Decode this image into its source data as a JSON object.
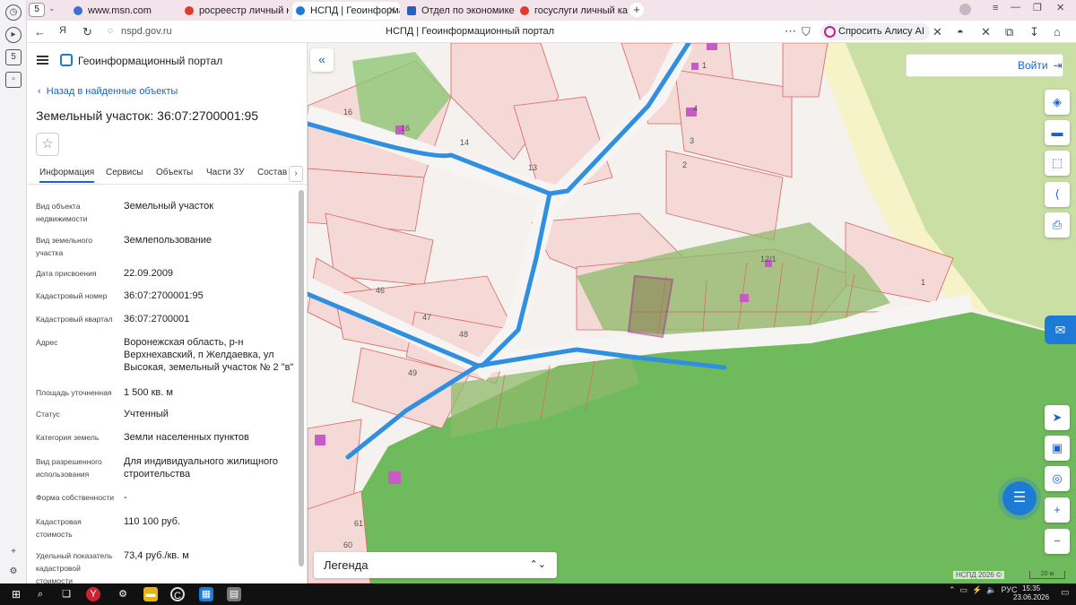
{
  "browser": {
    "tab_count": "5",
    "tabs": [
      {
        "label": "www.msn.com",
        "color": "#3b6fd1",
        "active": false
      },
      {
        "label": "росреестр личный кабин",
        "color": "#e3382b",
        "active": false
      },
      {
        "label": "НСПД | Геоинформаци",
        "color": "#1d7bd6",
        "active": true
      },
      {
        "label": "Отдел по экономике и уп",
        "color": "#2a5fbf",
        "active": false
      },
      {
        "label": "госуслуги личный кабин",
        "color": "#e3382b",
        "active": false
      }
    ],
    "new_tab": "+",
    "url": "nspd.gov.ru",
    "page_title": "НСПД | Геоинформационный портал",
    "alice_label": "Спросить Алису AI"
  },
  "sidebar": {
    "app_title": "Геоинформационный портал",
    "back_label": "Назад в найденные объекты",
    "object_title": "Земельный участок: 36:07:2700001:95",
    "tabs": [
      "Информация",
      "Сервисы",
      "Объекты",
      "Части ЗУ",
      "Состав"
    ],
    "fields": [
      {
        "label": "Вид объекта недвижимости",
        "value": "Земельный участок"
      },
      {
        "label": "Вид земельного участка",
        "value": "Землепользование"
      },
      {
        "label": "Дата присвоения",
        "value": "22.09.2009"
      },
      {
        "label": "Кадастровый номер",
        "value": "36:07:2700001:95"
      },
      {
        "label": "Кадастровый квартал",
        "value": "36:07:2700001"
      },
      {
        "label": "Адрес",
        "value": "Воронежская область, р-н Верхнехавский, п Желдаевка, ул Высокая, земельный участок № 2 \"в\""
      },
      {
        "label": "Площадь уточненная",
        "value": "1 500 кв. м"
      },
      {
        "label": "Статус",
        "value": "Учтенный"
      },
      {
        "label": "Категория земель",
        "value": "Земли населенных пунктов"
      },
      {
        "label": "Вид разрешенного использования",
        "value": "Для индивидуального жилищного строительства"
      },
      {
        "label": "Форма собственности",
        "value": "-"
      },
      {
        "label": "Кадастровая стоимость",
        "value": "110 100 руб."
      },
      {
        "label": "Удельный показатель кадастровой стоимости",
        "value": "73,4 руб./кв. м"
      }
    ]
  },
  "map": {
    "login_label": "Войти",
    "legend_label": "Легенда",
    "copyright": "НСПД 2026 ©",
    "scale": "20 м",
    "parcel_numbers": [
      "16",
      "16",
      "14",
      "13",
      "1",
      "4",
      "3",
      "2",
      "12/1",
      "1",
      "46",
      "47",
      "48",
      "49",
      "61",
      "60"
    ],
    "colors": {
      "parcel_fill": "#f4d9d6",
      "parcel_line": "#d9645f",
      "forest": "#6fba5c",
      "road": "#2f8fe0",
      "selected": "#a0158b"
    }
  },
  "taskbar": {
    "tray_lang": "РУС",
    "time": "15:35",
    "date": "23.06.2026"
  }
}
